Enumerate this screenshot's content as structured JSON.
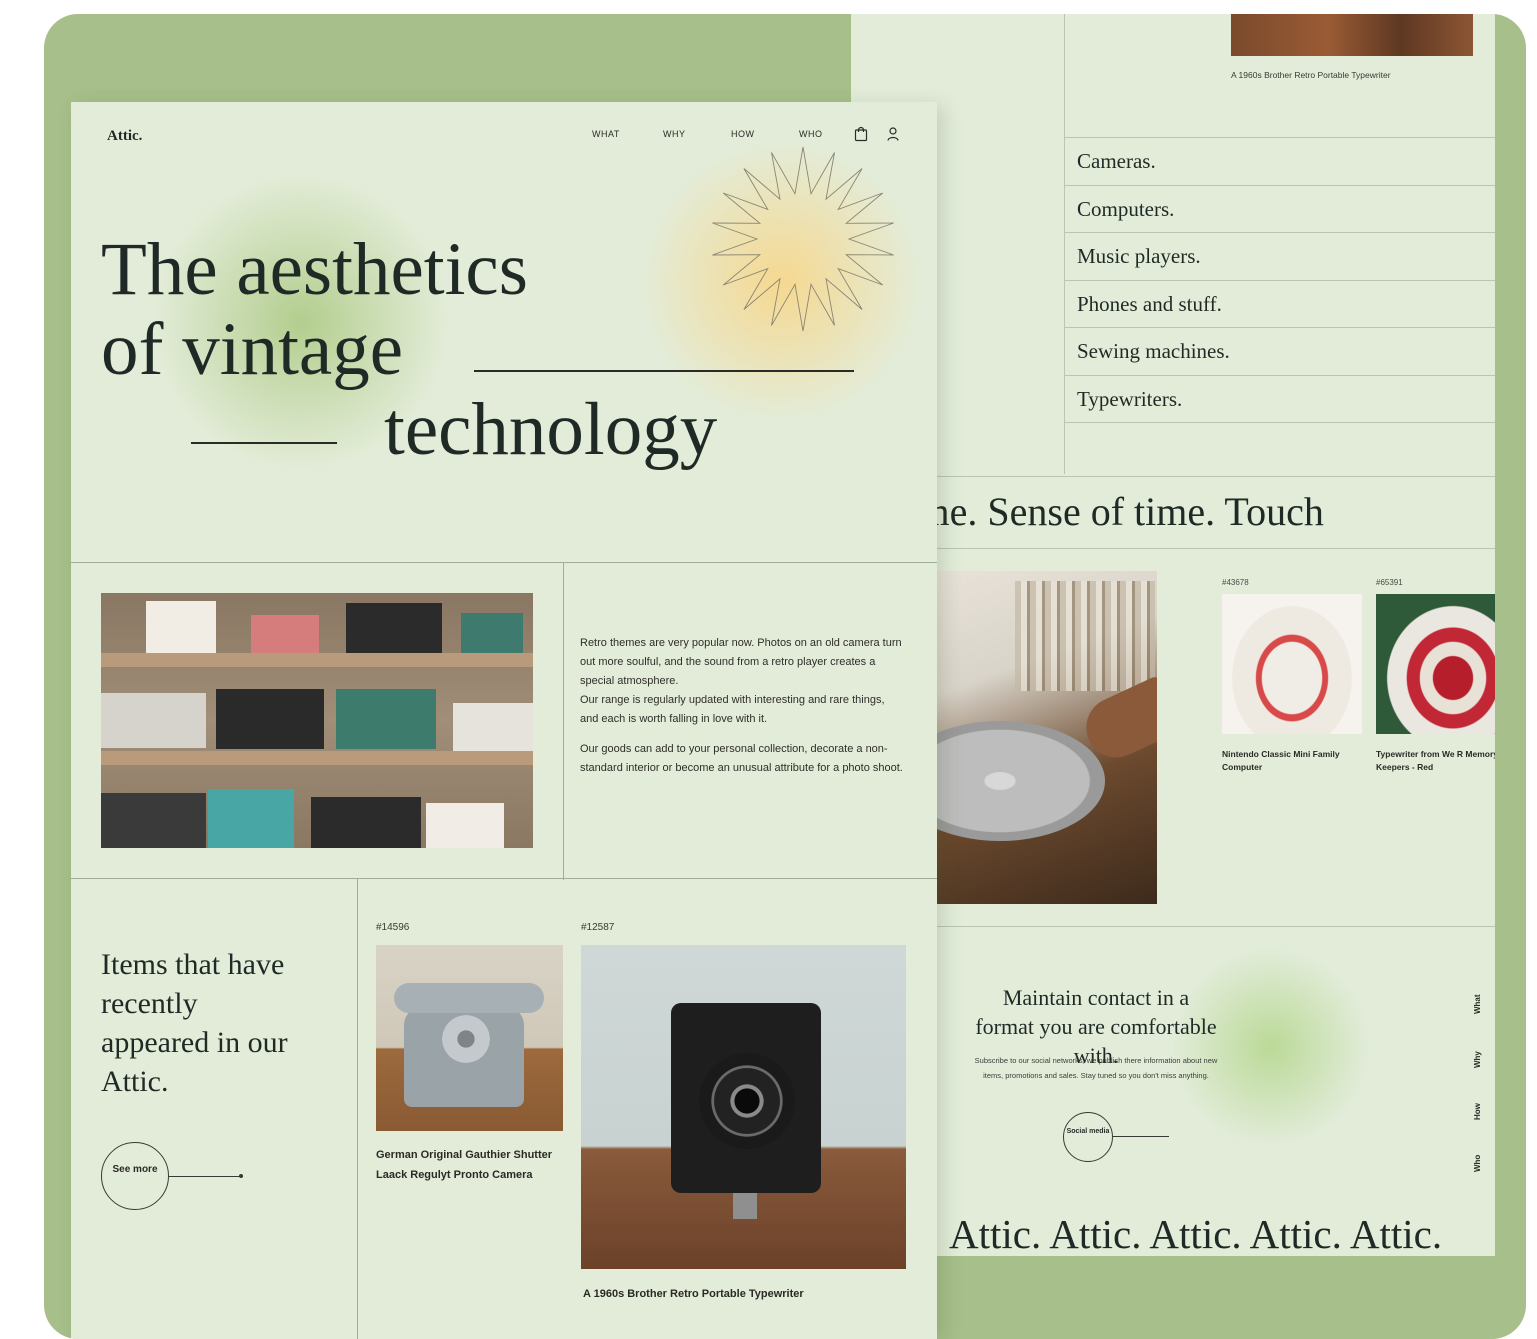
{
  "colors": {
    "frame": "#a7bf8a",
    "page": "#e3ecd8",
    "ink": "#1f2a27",
    "accent_yellow": "#f7d78c",
    "accent_green": "#b0cc8a"
  },
  "front": {
    "logo": "Attic.",
    "nav": [
      "WHAT",
      "WHY",
      "HOW",
      "WHO"
    ],
    "icons": {
      "cart": "shopping-bag-icon",
      "account": "user-icon"
    },
    "hero": {
      "line1": "The aesthetics",
      "line2": "of vintage",
      "line3": "technology"
    },
    "about": {
      "p1": "Retro themes are very popular now. Photos on an old camera turn out more soulful, and the sound from a retro player creates a special atmosphere.",
      "p2": "Our range is regularly updated with interesting and rare things, and each is worth falling in love with it.",
      "p3": "Our goods can add to your personal collection, decorate a non-standard interior or become an unusual attribute for a photo shoot."
    },
    "recent": {
      "title": "Items that have recently appeared in our Attic.",
      "see_more": "See more",
      "products": [
        {
          "code": "#14596",
          "name": "German Original Gauthier Shutter Laack Regulyt Pronto Camera"
        },
        {
          "code": "#12587",
          "name": "A 1960s Brother Retro Portable Typewriter"
        }
      ]
    }
  },
  "back": {
    "top_caption": "A 1960s Brother Retro Portable Typewriter",
    "categories": [
      "Cameras.",
      "Computers.",
      "Music players.",
      "Phones and stuff.",
      "Sewing machines.",
      "Typewriters."
    ],
    "ticker": "n of time. Sense of time. Touch",
    "products": [
      {
        "code": "#43678",
        "name": "Nintendo Classic Mini Family Computer"
      },
      {
        "code": "#65391",
        "name": "Typewriter from We R Memory Keepers - Red"
      }
    ],
    "contact": {
      "title": "Maintain contact in a format you are comfortable with.",
      "desc": "Subscribe to our social networks, we publish there information about new items, promotions and sales. Stay tuned so you don't miss anything.",
      "social_button": "Social media",
      "vnav": [
        "What",
        "Why",
        "How",
        "Who"
      ]
    },
    "bottom_ticker": "Attic. Attic. Attic. Attic. Attic."
  }
}
